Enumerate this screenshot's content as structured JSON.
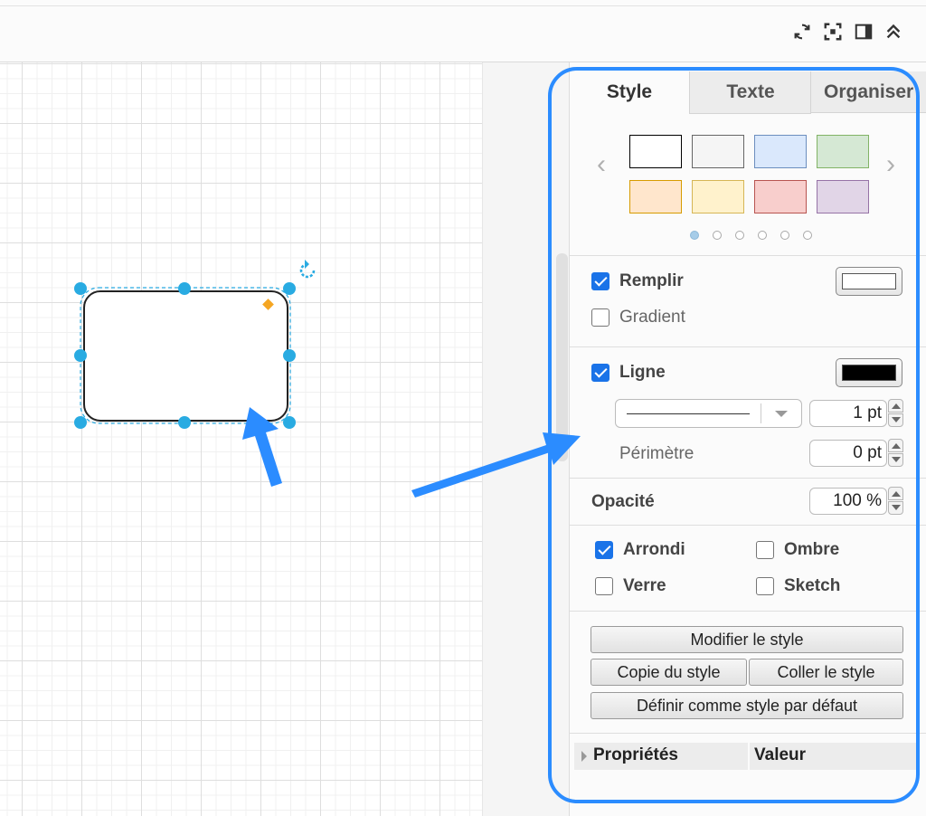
{
  "tabs": [
    "Style",
    "Texte",
    "Organiser"
  ],
  "palette": {
    "swatches": [
      {
        "fill": "#ffffff",
        "stroke": "#000000"
      },
      {
        "fill": "#f5f5f5",
        "stroke": "#666666"
      },
      {
        "fill": "#dae8fc",
        "stroke": "#6c8ebf"
      },
      {
        "fill": "#d5e8d4",
        "stroke": "#82b366"
      },
      {
        "fill": "#ffe6cc",
        "stroke": "#d79b00"
      },
      {
        "fill": "#fff2cc",
        "stroke": "#d6b656"
      },
      {
        "fill": "#f8cecc",
        "stroke": "#b85450"
      },
      {
        "fill": "#e1d5e7",
        "stroke": "#9673a6"
      }
    ],
    "prev_glyph": "‹",
    "next_glyph": "›",
    "page_count": 6,
    "active_page": 1
  },
  "fill": {
    "label": "Remplir",
    "checked": true,
    "color": "#ffffff",
    "gradient_label": "Gradient",
    "gradient_checked": false
  },
  "line": {
    "label": "Ligne",
    "checked": true,
    "color": "#000000",
    "width": "1 pt",
    "perimeter_label": "Périmètre",
    "perimeter": "0 pt"
  },
  "opacity": {
    "label": "Opacité",
    "value": "100 %"
  },
  "options": {
    "rounded": {
      "label": "Arrondi",
      "checked": true
    },
    "shadow": {
      "label": "Ombre",
      "checked": false
    },
    "glass": {
      "label": "Verre",
      "checked": false
    },
    "sketch": {
      "label": "Sketch",
      "checked": false
    }
  },
  "buttons": {
    "edit_style": "Modifier le style",
    "copy_style": "Copie du style",
    "paste_style": "Coller le style",
    "set_default": "Définir comme style par défaut"
  },
  "properties": {
    "col1": "Propriétés",
    "col2": "Valeur"
  },
  "toolbar_icons": [
    "sync-icon",
    "fullscreen-icon",
    "format-panel-icon",
    "collapse-icon"
  ],
  "colors": {
    "accent": "#1a73e8",
    "selection_handle": "#29abe2",
    "annotation": "#2b8cff",
    "handle_orange": "#f5a623"
  }
}
